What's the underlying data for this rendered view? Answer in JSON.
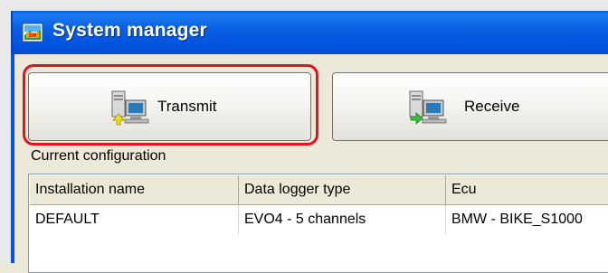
{
  "window": {
    "title": "System manager",
    "title_icon": "system-manager-app-icon"
  },
  "toolbar": {
    "transmit_label": "Transmit",
    "transmit_icon": "computer-transmit-icon",
    "receive_label": "Receive",
    "receive_icon": "computer-receive-icon",
    "highlighted_button": "transmit"
  },
  "configuration": {
    "section_label": "Current configuration",
    "columns": [
      "Installation name",
      "Data logger type",
      "Ecu"
    ],
    "rows": [
      [
        "DEFAULT",
        "EVO4 - 5 channels",
        "BMW - BIKE_S1000"
      ]
    ]
  },
  "colors": {
    "titlebar_blue": "#0a5fe0",
    "highlight_red": "#e8101a",
    "face": "#ece9d8"
  }
}
